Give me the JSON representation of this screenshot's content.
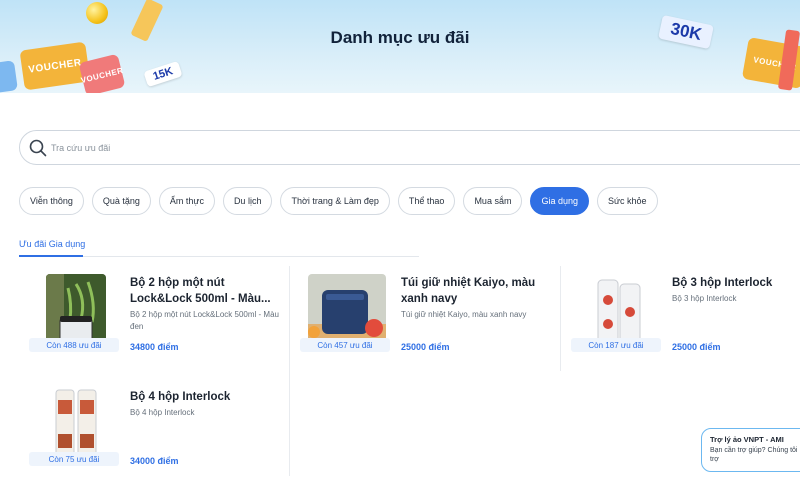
{
  "header": {
    "title": "Danh mục ưu đãi",
    "voucher_left_1": "VOUCHER",
    "voucher_left_2": "VOUCHER",
    "voucher_right": "VOUCHER",
    "tag_15k": "15K",
    "tag_30k": "30K"
  },
  "search": {
    "placeholder": "Tra cứu ưu đãi"
  },
  "categories": [
    {
      "label": "Viễn thông"
    },
    {
      "label": "Quà tặng"
    },
    {
      "label": "Ẩm thực"
    },
    {
      "label": "Du lịch"
    },
    {
      "label": "Thời trang & Làm đẹp"
    },
    {
      "label": "Thể thao"
    },
    {
      "label": "Mua sắm"
    },
    {
      "label": "Gia dụng",
      "active": true
    },
    {
      "label": "Sức khỏe"
    }
  ],
  "section": {
    "tab_label": "Ưu đãi Gia dụng"
  },
  "products": [
    {
      "title": "Bộ 2 hộp một nút Lock&Lock 500ml - Màu...",
      "subtitle": "Bộ 2 hộp một nút Lock&Lock 500ml - Màu đen",
      "stock": "Còn 488 ưu đãi",
      "price": "34800 điểm"
    },
    {
      "title": "Túi giữ nhiệt Kaiyo, màu xanh navy",
      "subtitle": "Túi giữ nhiệt Kaiyo, màu xanh navy",
      "stock": "Còn 457 ưu đãi",
      "price": "25000 điểm"
    },
    {
      "title": "Bộ 3 hộp Interlock",
      "subtitle": "Bộ 3 hộp Interlock",
      "stock": "Còn 187 ưu đãi",
      "price": "25000 điểm"
    },
    {
      "title": "Bộ 4 hộp Interlock",
      "subtitle": "Bộ 4 hộp Interlock",
      "stock": "Còn 75 ưu đãi",
      "price": "34000 điểm"
    }
  ],
  "chat": {
    "title": "Trợ lý ảo VNPT - AMI",
    "message": "Bạn cần trợ giúp? Chúng tôi trợ"
  },
  "colors": {
    "accent": "#2f6fe4",
    "banner": "#cfe9f7"
  }
}
